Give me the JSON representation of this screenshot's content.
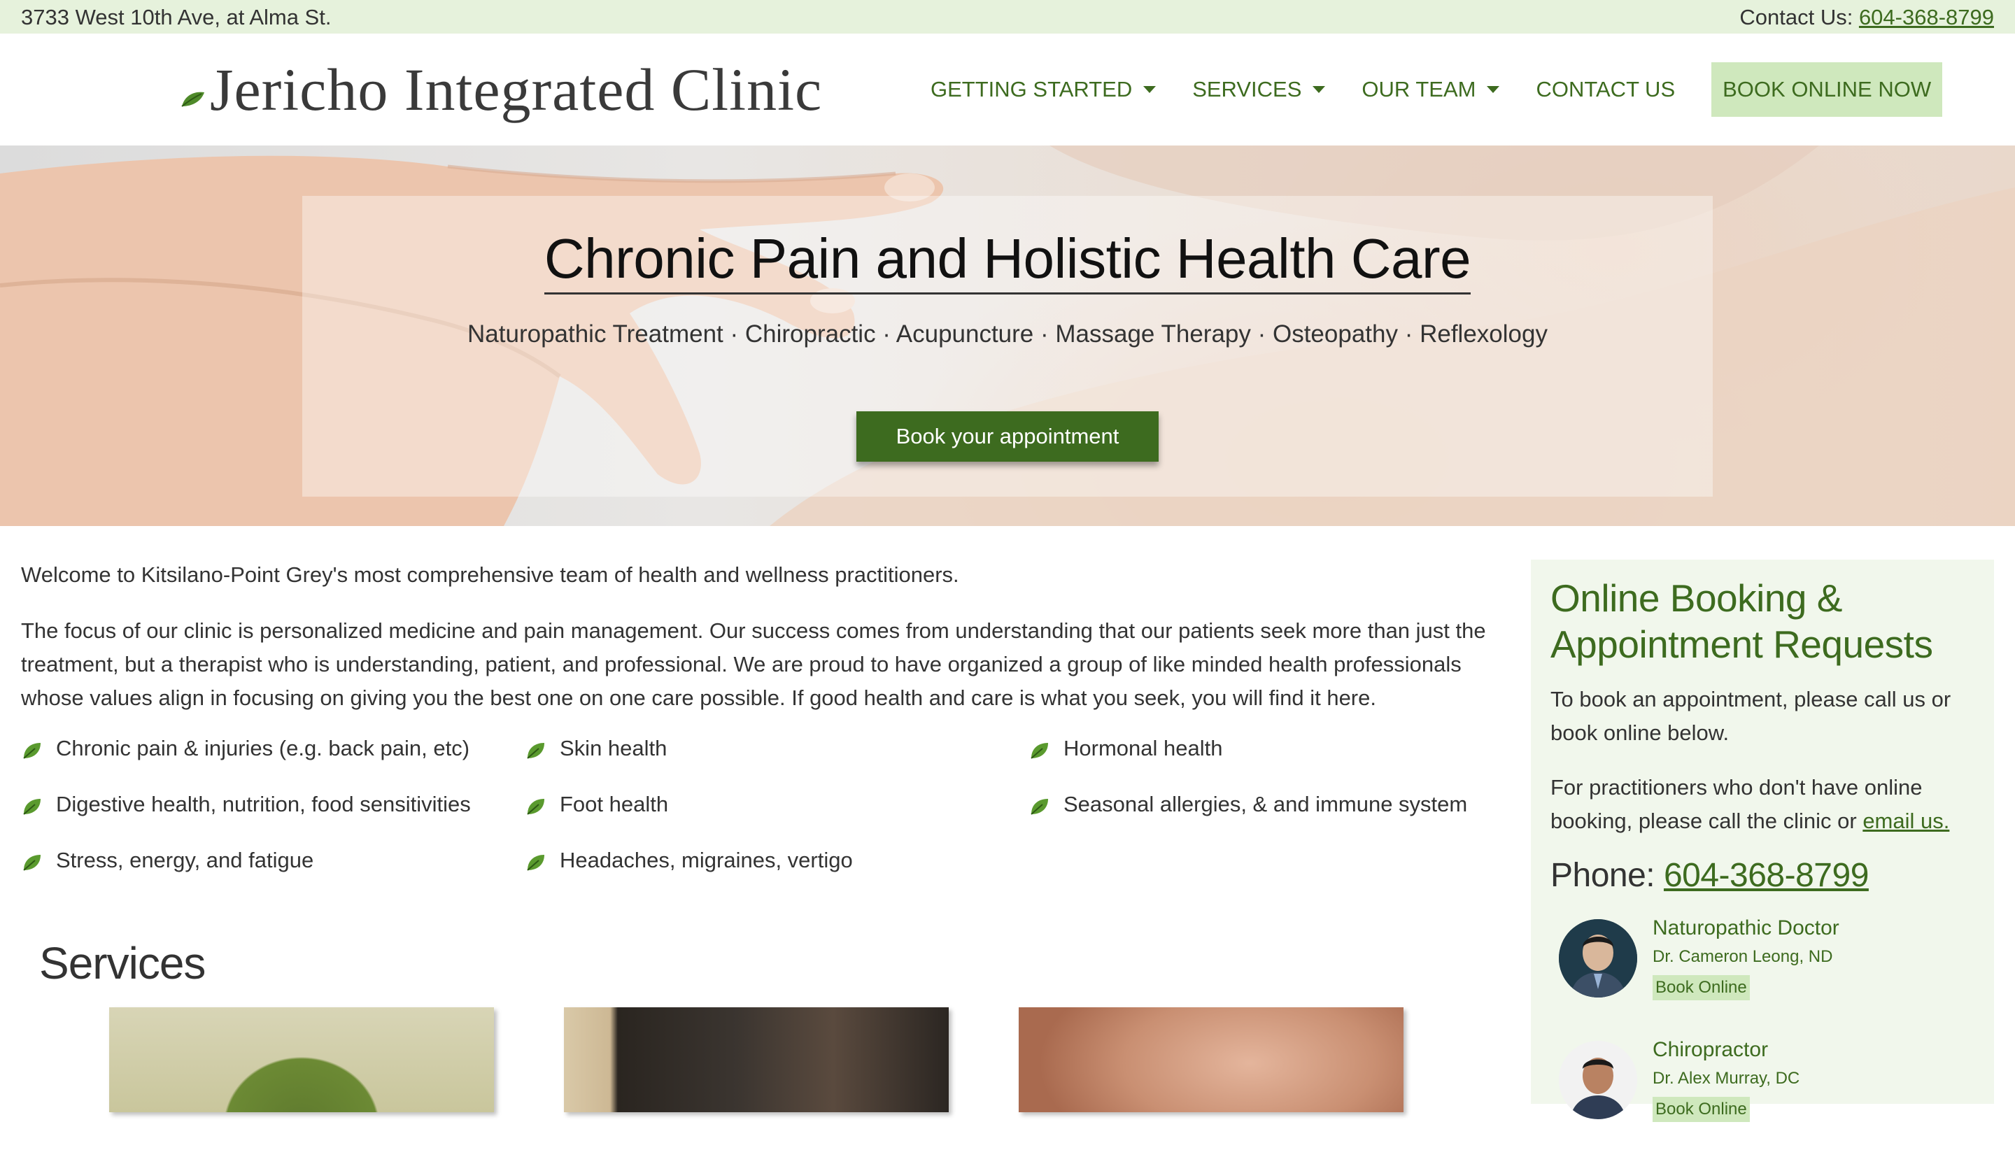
{
  "topbar": {
    "address": "3733 West 10th Ave, at Alma St.",
    "contact_label": "Contact Us: ",
    "contact_phone": "604-368-8799"
  },
  "header": {
    "logo_text": "Jericho Integrated Clinic",
    "nav": {
      "getting_started": "GETTING STARTED",
      "services": "SERVICES",
      "our_team": "OUR TEAM",
      "contact_us": "CONTACT US",
      "book_online": "BOOK ONLINE NOW"
    }
  },
  "hero": {
    "title": "Chronic Pain and Holistic Health Care",
    "subtitle": "Naturopathic Treatment · Chiropractic · Acupuncture · Massage Therapy · Osteopathy · Reflexology",
    "button": "Book your appointment"
  },
  "main": {
    "intro": "Welcome to Kitsilano-Point Grey's most comprehensive team of health and wellness practitioners.",
    "focus": "The focus of our clinic is personalized medicine and pain management. Our success comes from understanding that our patients seek more than just the treatment, but a therapist who is understanding, patient, and professional. We are proud to have organized a group of like minded health professionals whose values align in focusing on giving you the best one on one care possible. If good health and care is what you seek, you will find it here.",
    "conditions": [
      "Chronic pain & injuries (e.g. back pain, etc)",
      "Skin health",
      "Hormonal health",
      "Digestive health, nutrition, food sensitivities",
      "Foot health",
      "Seasonal allergies, & and immune system",
      "Stress, energy, and fatigue",
      "Headaches, migraines, vertigo"
    ],
    "services_title": "Services"
  },
  "sidebar": {
    "title": "Online Booking & Appointment Requests",
    "p1": "To book an appointment, please call us or book online below.",
    "p2_text": "For practitioners who don't have online booking, please call the clinic or ",
    "p2_link": "email us.",
    "phone_label": "Phone: ",
    "phone": "604-368-8799",
    "practitioners": [
      {
        "role": "Naturopathic Doctor",
        "name": "Dr. Cameron Leong, ND",
        "book": "Book Online"
      },
      {
        "role": "Chiropractor",
        "name": "Dr. Alex Murray, DC",
        "book": "Book Online"
      }
    ]
  },
  "colors": {
    "brand_green": "#3d6b1f",
    "light_green": "#cfe8bd",
    "topbar_bg": "#e6f2dc",
    "sidebar_bg": "#f1f7ec"
  }
}
